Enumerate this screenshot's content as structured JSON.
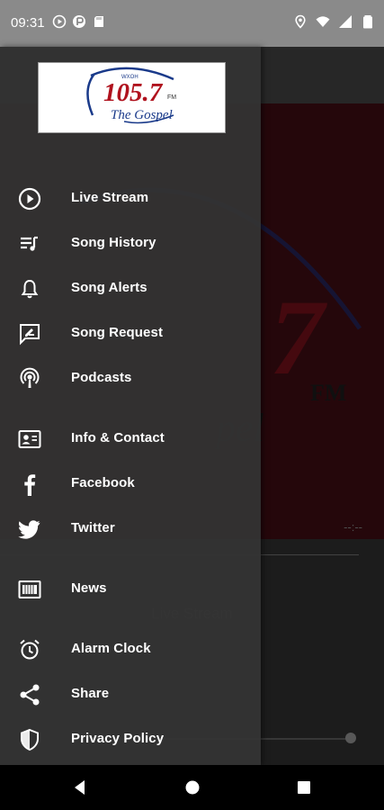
{
  "status_bar": {
    "time": "09:31"
  },
  "logo": {
    "call_letters": "WXOH",
    "frequency": "105.7",
    "band": "FM",
    "tagline": "The Gospel"
  },
  "background": {
    "now_playing": "Live Stream",
    "elapsed": "--:--"
  },
  "menu": {
    "items": [
      {
        "label": "Live Stream",
        "icon": "play-circle-icon"
      },
      {
        "label": "Song History",
        "icon": "playlist-icon"
      },
      {
        "label": "Song Alerts",
        "icon": "bell-icon"
      },
      {
        "label": "Song Request",
        "icon": "request-icon"
      },
      {
        "label": "Podcasts",
        "icon": "podcast-icon"
      },
      {
        "label": "Info & Contact",
        "icon": "contact-card-icon"
      },
      {
        "label": "Facebook",
        "icon": "facebook-icon"
      },
      {
        "label": "Twitter",
        "icon": "twitter-icon"
      },
      {
        "label": "News",
        "icon": "news-icon"
      },
      {
        "label": "Alarm Clock",
        "icon": "alarm-clock-icon"
      },
      {
        "label": "Share",
        "icon": "share-icon"
      },
      {
        "label": "Privacy Policy",
        "icon": "shield-icon"
      }
    ]
  },
  "colors": {
    "drawer": "#343434",
    "art_background": "#5a0e18",
    "logo_red": "#b0121e",
    "logo_blue": "#1a3a8a"
  }
}
